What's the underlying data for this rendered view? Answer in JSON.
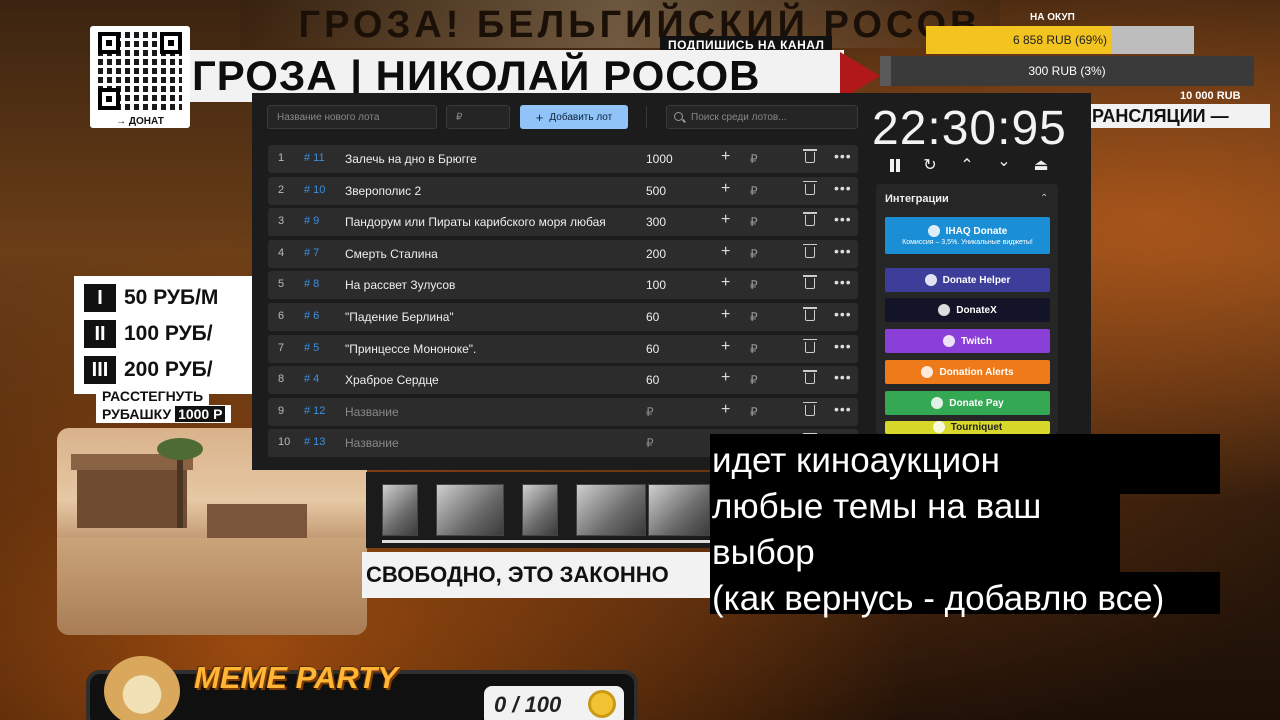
{
  "header": {
    "top_title": "ГРОЗА! БЕЛЬГИЙСКИЙ РОСОВ",
    "subscribe": "ПОДПИШИСЬ НА КАНАЛ",
    "main_title": "ГРОЗА | НИКОЛАЙ РОСОВ",
    "translation": "РАНСЛЯЦИИ —"
  },
  "qr": {
    "label": "→ ДОНАТ"
  },
  "goals": {
    "label": "НА ОКУП",
    "goal1_text": "6 858 RUB (69%)",
    "goal1_percent": 69,
    "goal2_text": "300 RUB (3%)",
    "goal2_percent": 3,
    "amount": "10 000 RUB"
  },
  "tiers": [
    {
      "num": "I",
      "text": "50 РУБ/М"
    },
    {
      "num": "II",
      "text": "100 РУБ/"
    },
    {
      "num": "III",
      "text": "200 РУБ/"
    }
  ],
  "unbutton": {
    "line1": "РАССТЕГНУТЬ",
    "line2": "РУБАШКУ",
    "amount": "1000 Р"
  },
  "free_text": "СВОБОДНО, ЭТО ЗАКОННО",
  "meme": {
    "title": "MEME PARTY",
    "count": "0 / 100"
  },
  "auction": {
    "lot_name_placeholder": "Название нового лота",
    "price_placeholder": "₽",
    "add_label": "Добавить лот",
    "search_placeholder": "Поиск среди лотов...",
    "rows": [
      {
        "idx": "1",
        "id": "# 11",
        "name": "Залечь на дно в Брюгге",
        "amount": "1000"
      },
      {
        "idx": "2",
        "id": "# 10",
        "name": "Зверополис 2",
        "amount": "500"
      },
      {
        "idx": "3",
        "id": "# 9",
        "name": "Пандорум или Пираты карибского моря любая",
        "amount": "300"
      },
      {
        "idx": "4",
        "id": "# 7",
        "name": "Смерть Сталина",
        "amount": "200"
      },
      {
        "idx": "5",
        "id": "# 8",
        "name": "На рассвет Зулусов",
        "amount": "100"
      },
      {
        "idx": "6",
        "id": "# 6",
        "name": "\"Падение Берлина\"",
        "amount": "60"
      },
      {
        "idx": "7",
        "id": "# 5",
        "name": "\"Принцессе Мононоке\".",
        "amount": "60"
      },
      {
        "idx": "8",
        "id": "# 4",
        "name": "Храброе Сердце",
        "amount": "60"
      },
      {
        "idx": "9",
        "id": "# 12",
        "name": "Название",
        "amount": "₽",
        "placeholder": true
      },
      {
        "idx": "10",
        "id": "# 13",
        "name": "Название",
        "amount": "₽",
        "placeholder": true
      }
    ],
    "rub": "₽",
    "timer": "22:30:95"
  },
  "integrations": {
    "title": "Интеграции",
    "items": [
      {
        "label": "IHAQ Donate",
        "sub": "Комиссия – 3,5%. Уникальные виджеты!",
        "color": "#1a8fd6",
        "icon": "ihaq-icon"
      },
      {
        "label": "Donate Helper",
        "color": "#3c3e9a",
        "icon": "donate-helper-icon"
      },
      {
        "label": "DonateX",
        "color": "#141428",
        "icon": "donatex-icon"
      },
      {
        "label": "Twitch",
        "color": "#8a3fd8",
        "icon": "twitch-icon"
      },
      {
        "label": "Donation Alerts",
        "color": "#ef7a1a",
        "icon": "donation-alerts-icon"
      },
      {
        "label": "Donate Pay",
        "color": "#34a853",
        "icon": "donatepay-icon"
      },
      {
        "label": "Tourniquet",
        "color": "#d8d82a",
        "icon": "tourniquet-icon"
      }
    ]
  },
  "subtitle": "идет киноаукцион\nлюбые темы на ваш\nвыбор\n(как вернусь - добавлю все)"
}
